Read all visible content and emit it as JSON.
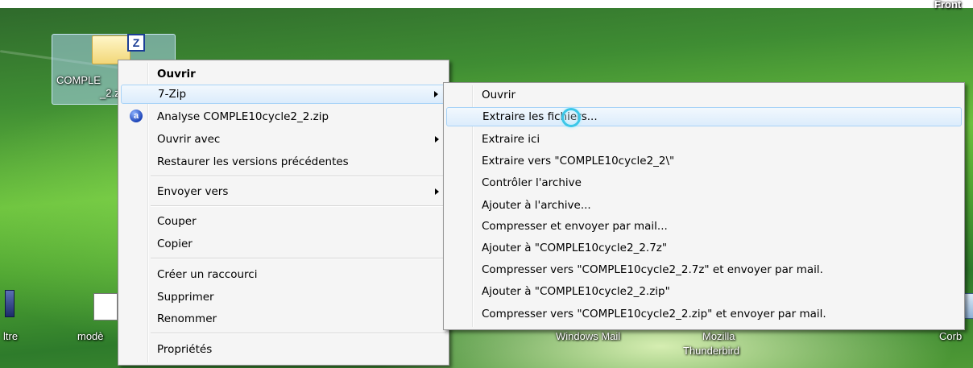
{
  "header_text": "Front",
  "desktop": {
    "zip_file": {
      "name_line1": "COMPLE",
      "name_line2": "_2.z"
    },
    "icons": {
      "left_label": "ltre",
      "model_label": "modè",
      "windows_mail": "Windows Mail",
      "mozilla_line1": "Mozilla",
      "mozilla_line2": "Thunderbird",
      "right_label": "Corb"
    }
  },
  "context_menu": {
    "items": [
      {
        "label": "Ouvrir",
        "bold": true
      },
      {
        "label": "7-Zip",
        "submenu": true,
        "highlighted": true
      },
      {
        "label": "Analyse COMPLE10cycle2_2.zip",
        "icon": "antivirus-icon"
      },
      {
        "label": "Ouvrir avec",
        "submenu": true
      },
      {
        "label": "Restaurer les versions précédentes"
      },
      {
        "label": "Envoyer vers",
        "submenu": true
      },
      {
        "label": "Couper"
      },
      {
        "label": "Copier"
      },
      {
        "label": "Créer un raccourci"
      },
      {
        "label": "Supprimer"
      },
      {
        "label": "Renommer"
      },
      {
        "label": "Propriétés"
      }
    ]
  },
  "zip_submenu": {
    "items": [
      {
        "label": "Ouvrir"
      },
      {
        "label": "Extraire les fichiers...",
        "highlighted": true
      },
      {
        "label": "Extraire ici"
      },
      {
        "label": "Extraire vers \"COMPLE10cycle2_2\\\""
      },
      {
        "label": "Contrôler l'archive"
      },
      {
        "label": "Ajouter à l'archive..."
      },
      {
        "label": "Compresser et envoyer par mail..."
      },
      {
        "label": "Ajouter à \"COMPLE10cycle2_2.7z\""
      },
      {
        "label": "Compresser vers \"COMPLE10cycle2_2.7z\" et envoyer par mail."
      },
      {
        "label": "Ajouter à \"COMPLE10cycle2_2.zip\""
      },
      {
        "label": "Compresser vers \"COMPLE10cycle2_2.zip\" et envoyer par mail."
      }
    ]
  },
  "cursor": {
    "type": "busy-ring"
  }
}
